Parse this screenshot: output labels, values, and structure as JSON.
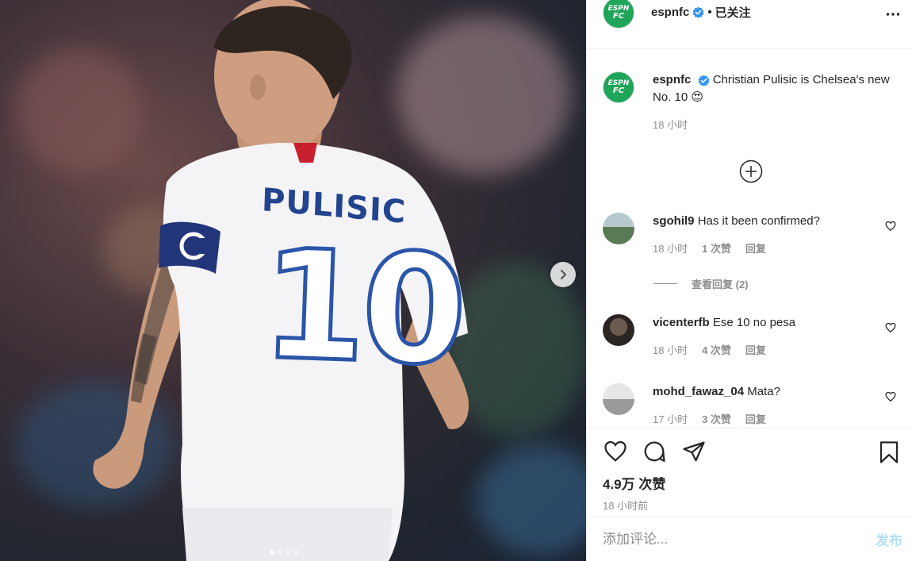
{
  "account": {
    "username": "espnfc",
    "avatar_line1": "ESPN",
    "avatar_line2": "FC",
    "follow_status": "已关注",
    "separator": "•"
  },
  "media": {
    "jersey_name": "PULISIC",
    "jersey_number": "10",
    "carousel_dot_count": 4,
    "carousel_active_index": 0
  },
  "caption": {
    "username": "espnfc",
    "text": "Christian Pulisic is Chelsea's new No. 10 😍",
    "time": "18 小时"
  },
  "comments": [
    {
      "username": "sgohil9",
      "text": "Has it been confirmed?",
      "time": "18 小时",
      "likes": "1 次赞",
      "reply": "回复",
      "avatar_color": "#5a7a55"
    },
    {
      "username": "vicenterfb",
      "text": "Ese 10 no pesa",
      "time": "18 小时",
      "likes": "4 次赞",
      "reply": "回复",
      "avatar_color": "#3a3230"
    },
    {
      "username": "mohd_fawaz_04",
      "text": "Mata?",
      "time": "17 小时",
      "likes": "3 次赞",
      "reply": "回复",
      "avatar_color": "#b8b8b8"
    }
  ],
  "view_replies": "查看回复 (2)",
  "stats": {
    "likes": "4.9万 次赞",
    "posted_ago": "18 小时前"
  },
  "comment_input": {
    "placeholder": "添加评论...",
    "post_label": "发布"
  },
  "colors": {
    "verified_blue": "#3897f0",
    "brand_green": "#1fa55a",
    "post_button_disabled": "#b2dffc"
  },
  "icons": [
    "verified-badge-icon",
    "more-options-icon",
    "add-circle-icon",
    "heart-icon",
    "comment-icon",
    "share-icon",
    "bookmark-icon",
    "chevron-right-icon"
  ]
}
